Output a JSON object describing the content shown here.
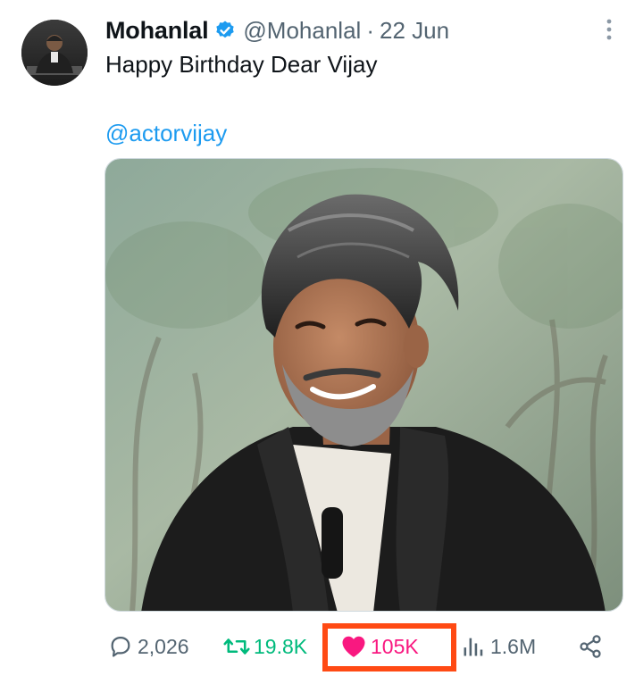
{
  "tweet": {
    "author": {
      "display_name": "Mohanlal",
      "handle": "@Mohanlal",
      "verified_icon": "verified-badge-icon",
      "avatar": "profile-photo"
    },
    "separator": "·",
    "date": "22 Jun",
    "text": "Happy Birthday Dear Vijay",
    "mention": "@actorvijay",
    "media": "photo-of-smiling-man-with-grey-beard-black-jacket",
    "more_icon": "more-options-icon"
  },
  "actions": {
    "reply": {
      "icon": "reply-icon",
      "count": "2,026"
    },
    "retweet": {
      "icon": "retweet-icon",
      "count": "19.8K"
    },
    "like": {
      "icon": "heart-icon",
      "count": "105K",
      "liked": true
    },
    "views": {
      "icon": "views-chart-icon",
      "count": "1.6M"
    },
    "share": {
      "icon": "share-icon"
    }
  },
  "colors": {
    "text": "#0f1419",
    "secondary": "#536471",
    "link": "#1d9bf0",
    "retweet": "#00ba7c",
    "like": "#f91880",
    "highlight": "#ff4a14"
  }
}
